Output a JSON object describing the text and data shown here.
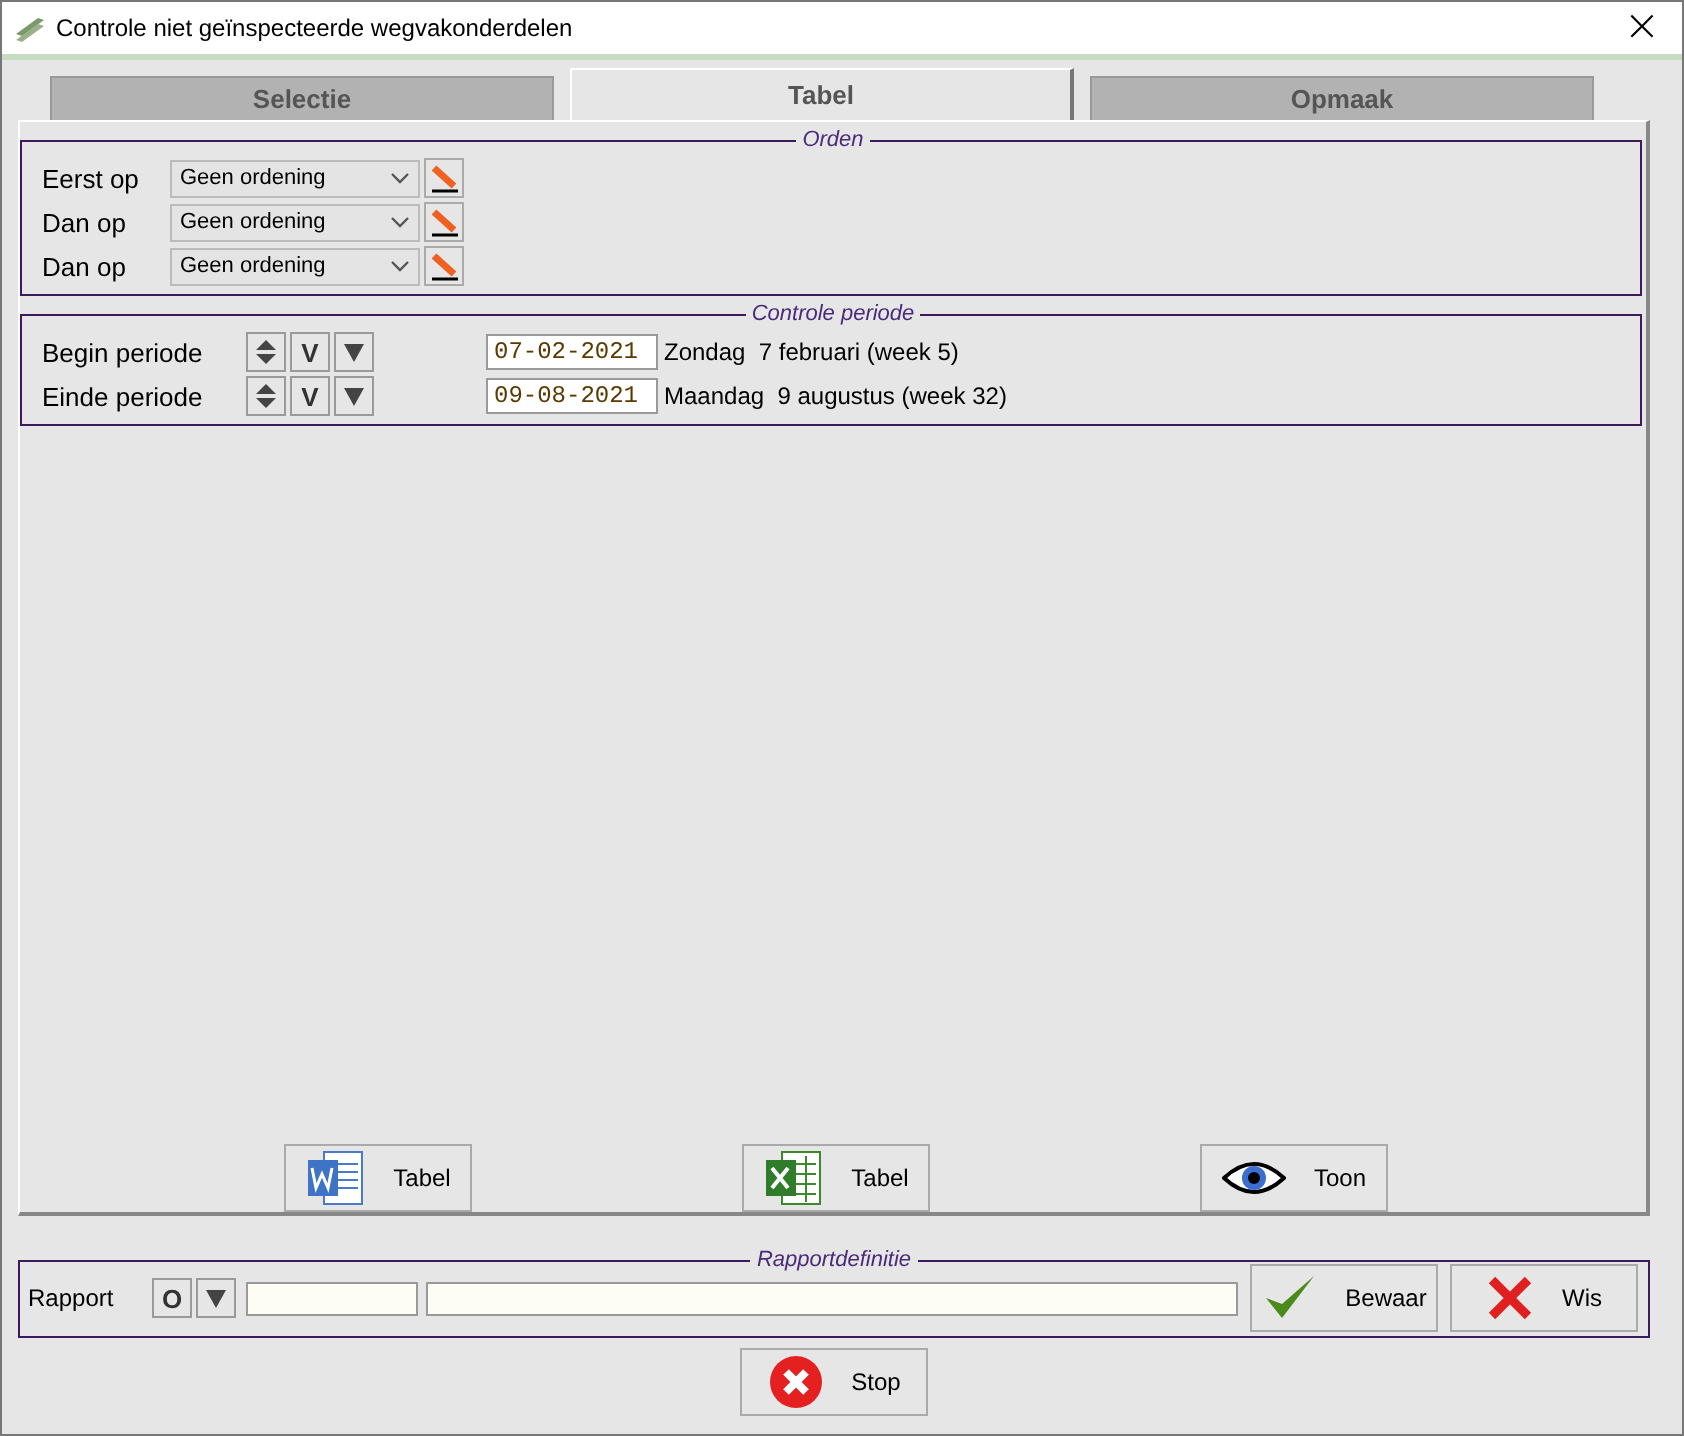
{
  "window": {
    "title": "Controle niet geïnspecteerde wegvakonderdelen",
    "close": "×"
  },
  "tabs": [
    {
      "label": "Selectie",
      "selected": false
    },
    {
      "label": "Tabel",
      "selected": true
    },
    {
      "label": "Opmaak",
      "selected": false
    }
  ],
  "orden": {
    "title": "Orden",
    "rows": [
      {
        "label": "Eerst op",
        "value": "Geen ordening"
      },
      {
        "label": "Dan op",
        "value": "Geen ordening"
      },
      {
        "label": "Dan op",
        "value": "Geen ordening"
      }
    ]
  },
  "periode": {
    "title": "Controle periode",
    "rows": [
      {
        "label": "Begin periode",
        "today": "V",
        "date": "07-02-2021",
        "description": "Zondag  7 februari (week 5)"
      },
      {
        "label": "Einde periode",
        "today": "V",
        "date": "09-08-2021",
        "description": "Maandag  9 augustus (week 32)"
      }
    ]
  },
  "actions": [
    {
      "kind": "word",
      "label": "Tabel"
    },
    {
      "kind": "excel",
      "label": "Tabel"
    },
    {
      "kind": "view",
      "label": "Toon"
    }
  ],
  "rapport": {
    "title": "Rapportdefinitie",
    "label": "Rapport",
    "open": "O",
    "save": "Bewaar",
    "clear": "Wis"
  },
  "stop": "Stop"
}
